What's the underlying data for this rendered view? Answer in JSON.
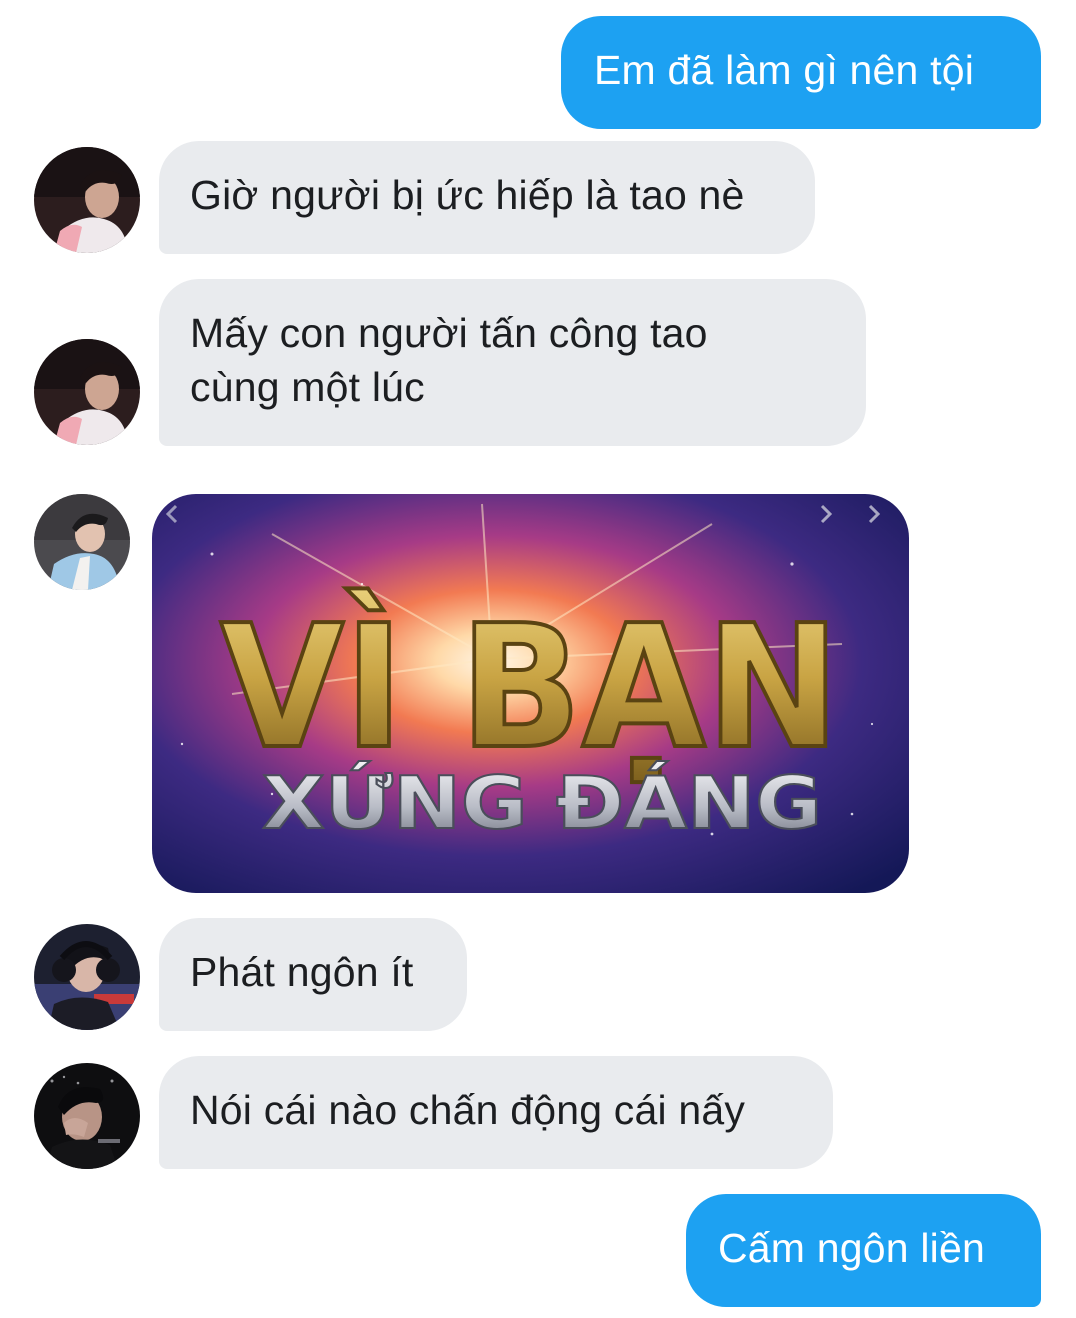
{
  "messages": [
    {
      "id": "m1",
      "direction": "outgoing",
      "text": "Em đã làm gì nên tội"
    },
    {
      "id": "m2",
      "direction": "incoming",
      "text": "Giờ người bị ức hiếp là tao nè",
      "avatar": "avatar-1"
    },
    {
      "id": "m3",
      "direction": "incoming",
      "text": "Mấy con người tấn công tao cùng một lúc",
      "avatar": "avatar-1"
    },
    {
      "id": "m4",
      "direction": "incoming",
      "type": "image",
      "avatar": "avatar-2",
      "image_text": {
        "line1": "VÌ BẠN",
        "line2": "XỨNG ĐÁNG"
      }
    },
    {
      "id": "m5",
      "direction": "incoming",
      "text": "Phát ngôn ít",
      "avatar": "avatar-3"
    },
    {
      "id": "m6",
      "direction": "incoming",
      "text": "Nói cái nào chấn động cái nấy",
      "avatar": "avatar-4"
    },
    {
      "id": "m7",
      "direction": "outgoing",
      "text": "Cấm ngôn liền"
    }
  ],
  "colors": {
    "outgoing_bubble": "#1da1f2",
    "incoming_bubble": "#e9ebee",
    "outgoing_text": "#ffffff",
    "incoming_text": "#1c1e21"
  },
  "icons": {
    "image_prev": "chevron-left-icon",
    "image_next": "chevron-right-icon"
  }
}
